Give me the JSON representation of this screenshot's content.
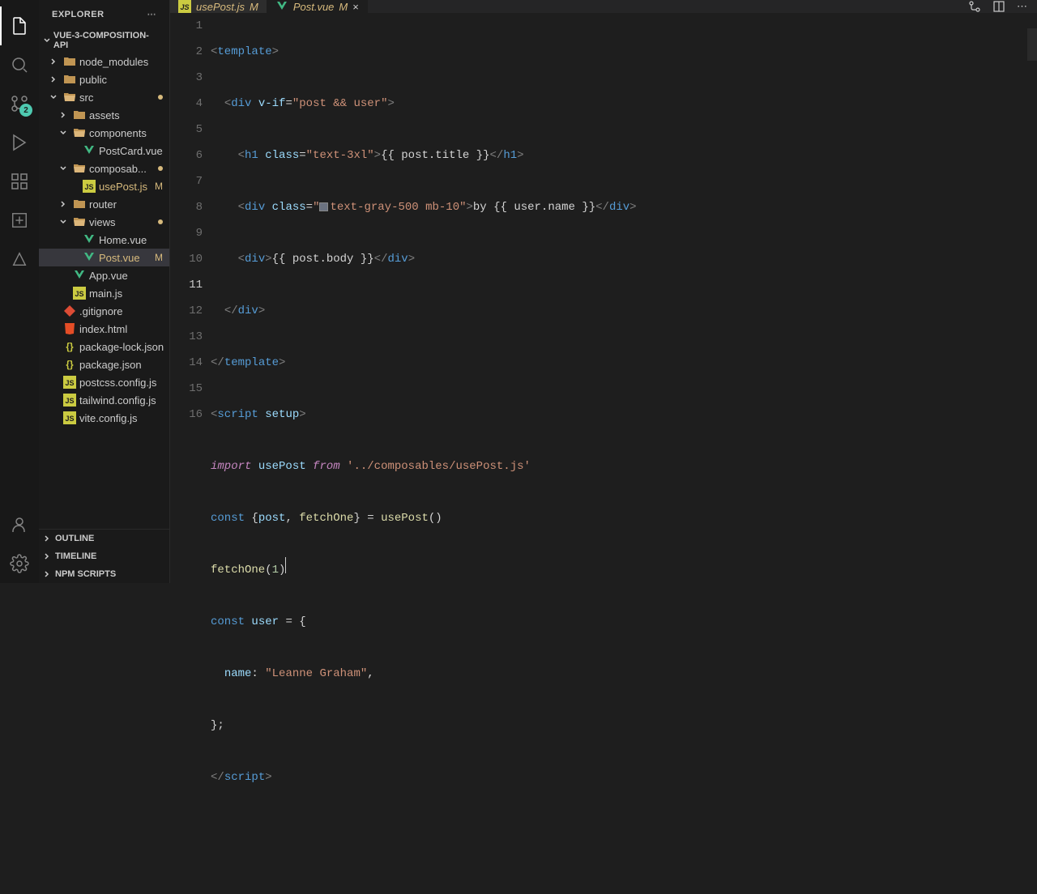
{
  "sidebar": {
    "title": "EXPLORER",
    "project": "VUE-3-COMPOSITION-API",
    "tree": [
      {
        "label": "node_modules",
        "type": "folder-closed"
      },
      {
        "label": "public",
        "type": "folder-closed"
      },
      {
        "label": "src",
        "type": "folder-open",
        "mod": true
      },
      {
        "label": "assets",
        "type": "folder-closed"
      },
      {
        "label": "components",
        "type": "folder-open"
      },
      {
        "label": "PostCard.vue",
        "type": "vue"
      },
      {
        "label": "composab...",
        "type": "folder-open",
        "mod": true
      },
      {
        "label": "usePost.js",
        "type": "js",
        "mod": "M"
      },
      {
        "label": "router",
        "type": "folder-closed"
      },
      {
        "label": "views",
        "type": "folder-open",
        "mod": true
      },
      {
        "label": "Home.vue",
        "type": "vue"
      },
      {
        "label": "Post.vue",
        "type": "vue",
        "mod": "M",
        "selected": true
      },
      {
        "label": "App.vue",
        "type": "vue"
      },
      {
        "label": "main.js",
        "type": "js"
      },
      {
        "label": ".gitignore",
        "type": "git"
      },
      {
        "label": "index.html",
        "type": "html"
      },
      {
        "label": "package-lock.json",
        "type": "json"
      },
      {
        "label": "package.json",
        "type": "json"
      },
      {
        "label": "postcss.config.js",
        "type": "js"
      },
      {
        "label": "tailwind.config.js",
        "type": "js"
      },
      {
        "label": "vite.config.js",
        "type": "js"
      }
    ],
    "footer": [
      "OUTLINE",
      "TIMELINE",
      "NPM SCRIPTS"
    ]
  },
  "tabs": [
    {
      "label": "usePost.js",
      "icon": "js",
      "mod": "M",
      "active": false
    },
    {
      "label": "Post.vue",
      "icon": "vue",
      "mod": "M",
      "active": true
    }
  ],
  "scm_badge": "2",
  "code": {
    "lines": [
      1,
      2,
      3,
      4,
      5,
      6,
      7,
      8,
      9,
      10,
      11,
      12,
      13,
      14,
      15,
      16
    ],
    "active_line": 11,
    "l1": {
      "t1": "<",
      "t2": "template",
      "t3": ">"
    },
    "l2": {
      "t1": "<",
      "t2": "div",
      "a1": "v-if",
      "s1": "\"post && user\"",
      "t3": ">"
    },
    "l3": {
      "t1": "<",
      "t2": "h1",
      "a1": "class",
      "s1": "\"text-3xl\"",
      "t3": ">",
      "c1": "{{ post.title }}",
      "t4": "</",
      "t5": "h1",
      "t6": ">"
    },
    "l4": {
      "t1": "<",
      "t2": "div",
      "a1": "class",
      "s1": "\"",
      "s2": "text-gray-500 mb-10\"",
      "t3": ">",
      "c1": "by {{ user.name }}",
      "t4": "</",
      "t5": "div",
      "t6": ">"
    },
    "l5": {
      "t1": "<",
      "t2": "div",
      "t3": ">",
      "c1": "{{ post.body }}",
      "t4": "</",
      "t5": "div",
      "t6": ">"
    },
    "l6": {
      "t1": "</",
      "t2": "div",
      "t3": ">"
    },
    "l7": {
      "t1": "</",
      "t2": "template",
      "t3": ">"
    },
    "l8": {
      "t1": "<",
      "t2": "script",
      "a1": "setup",
      "t3": ">"
    },
    "l9": {
      "k1": "import",
      "v1": " usePost ",
      "k2": "from",
      "s1": " '../composables/usePost.js'"
    },
    "l10": {
      "k1": "const",
      "p1": " {",
      "v1": "post",
      "p2": ", ",
      "f1": "fetchOne",
      "p3": "} = ",
      "f2": "usePost",
      "p4": "()"
    },
    "l11": {
      "f1": "fetchOne",
      "p1": "(",
      "n1": "1",
      "p2": ")"
    },
    "l12": {
      "k1": "const",
      "v1": " user ",
      "p1": "= {"
    },
    "l13": {
      "pr1": "name",
      "p1": ": ",
      "s1": "\"Leanne Graham\"",
      "p2": ","
    },
    "l14": {
      "p1": "};"
    },
    "l15": {
      "t1": "</",
      "t2": "script",
      "t3": ">"
    }
  }
}
